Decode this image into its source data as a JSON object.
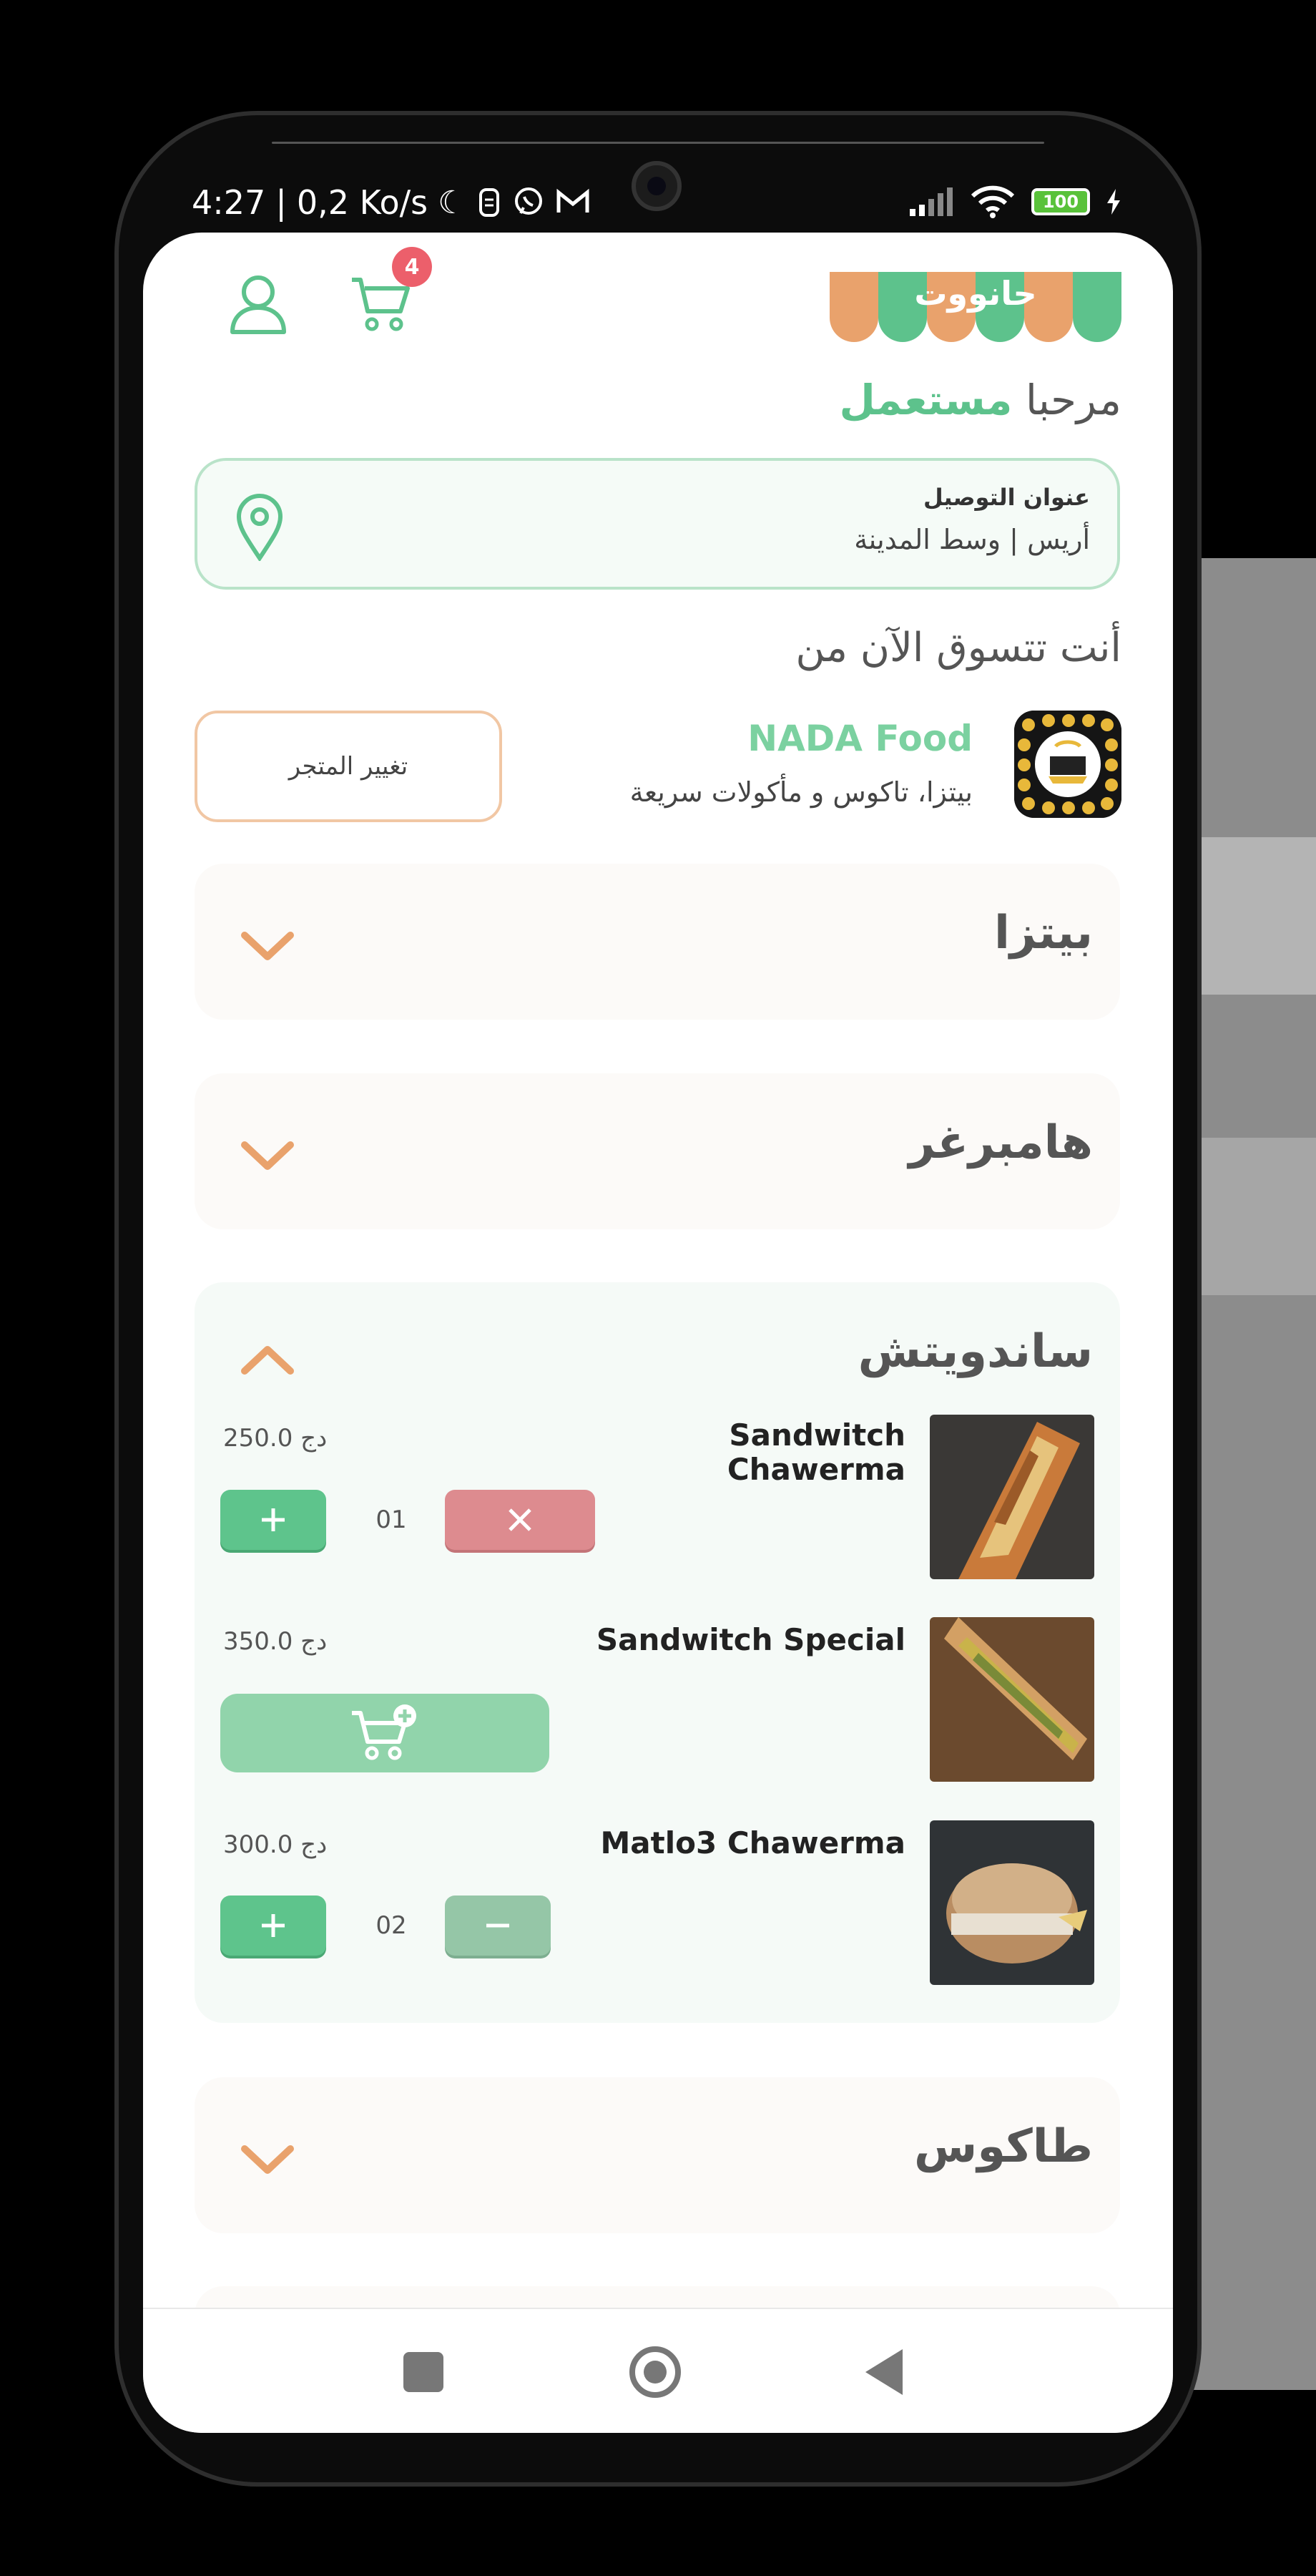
{
  "status_bar": {
    "time": "4:27",
    "separator": "|",
    "speed": "0,2 Ko/s",
    "battery": "100"
  },
  "header": {
    "logo_text": "حانووت",
    "cart_count": "4"
  },
  "welcome": {
    "greeting": "مرحبا",
    "user": "مستعمل"
  },
  "address": {
    "title": "عنوان التوصيل",
    "value": "أريس | وسط المدينة"
  },
  "shopping_from": "أنت تتسوق الآن من",
  "store": {
    "name": "NADA Food",
    "description": "بيتزا، تاكوس و مأكولات سريعة",
    "change_label": "تغيير المتجر"
  },
  "categories": [
    {
      "title": "بيتزا",
      "open": false
    },
    {
      "title": "هامبرغر",
      "open": false
    },
    {
      "title": "ساندويتش",
      "open": true
    },
    {
      "title": "طاكوس",
      "open": false
    }
  ],
  "items": [
    {
      "name_line1": "Sandwitch",
      "name_line2": "Chawerma",
      "price": "250.0 دج",
      "qty": "01"
    },
    {
      "name": "Sandwitch Special",
      "price": "350.0 دج"
    },
    {
      "name": "Matlo3 Chawerma",
      "price": "300.0 دج",
      "qty": "02"
    }
  ],
  "colors": {
    "accent_green": "#5dc28c",
    "accent_orange": "#e9a26c",
    "remove_red": "#dd8b8f"
  }
}
